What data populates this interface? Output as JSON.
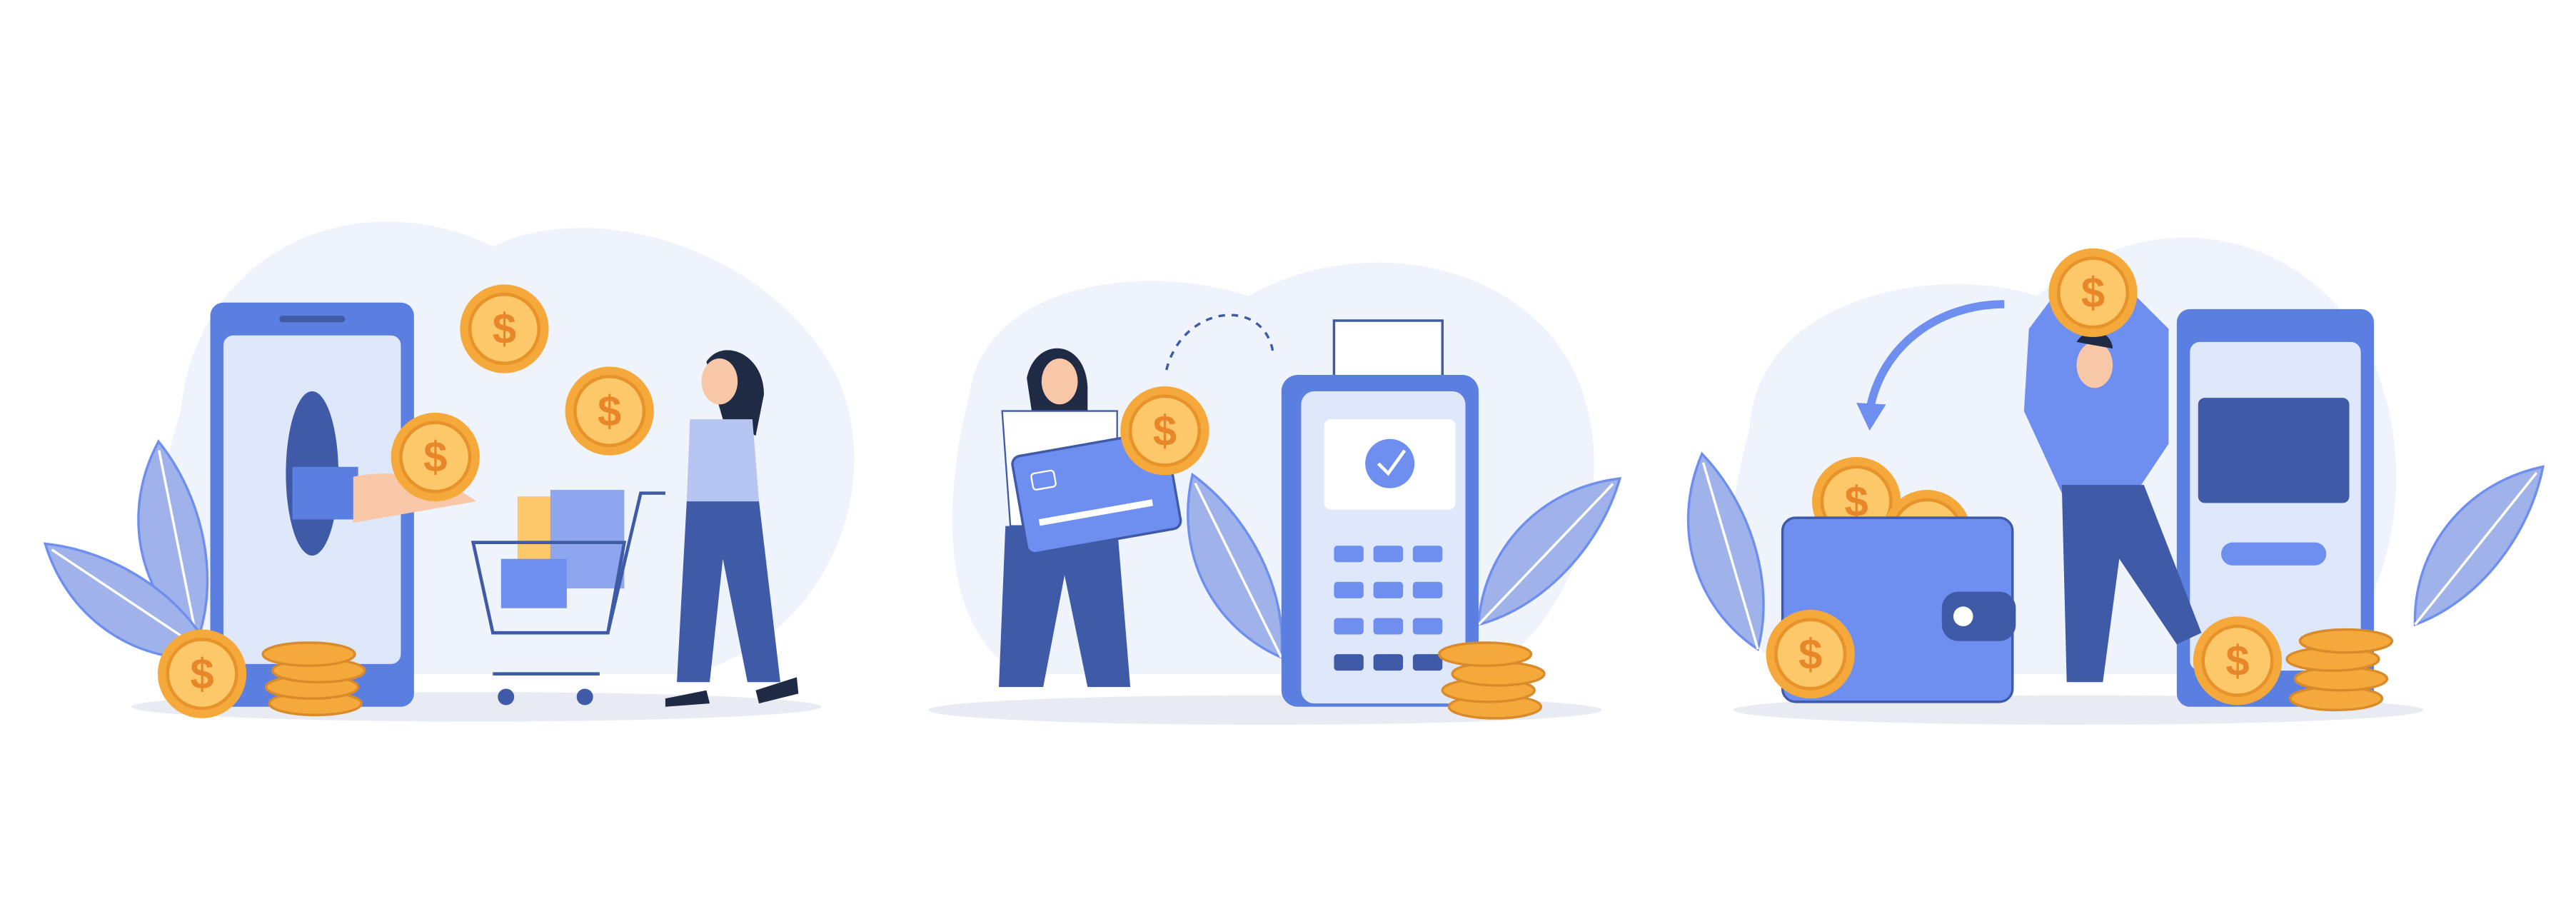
{
  "colors": {
    "background": "#ffffff",
    "blob": "#eef3fc",
    "phone_body": "#5b7fe0",
    "phone_screen": "#dfe7fb",
    "primary_blue": "#3f5ba8",
    "light_blue": "#6f8ff0",
    "coin_gold": "#f6a93b",
    "coin_light": "#fcc869",
    "leaf": "#9fb2ea",
    "shadow": "#e8ebf2",
    "skin": "#f7c7a8",
    "hair": "#1f2a44"
  },
  "scenes": [
    {
      "name": "online-shopping-payment"
    },
    {
      "name": "card-terminal-payment"
    },
    {
      "name": "wallet-cashback"
    }
  ]
}
